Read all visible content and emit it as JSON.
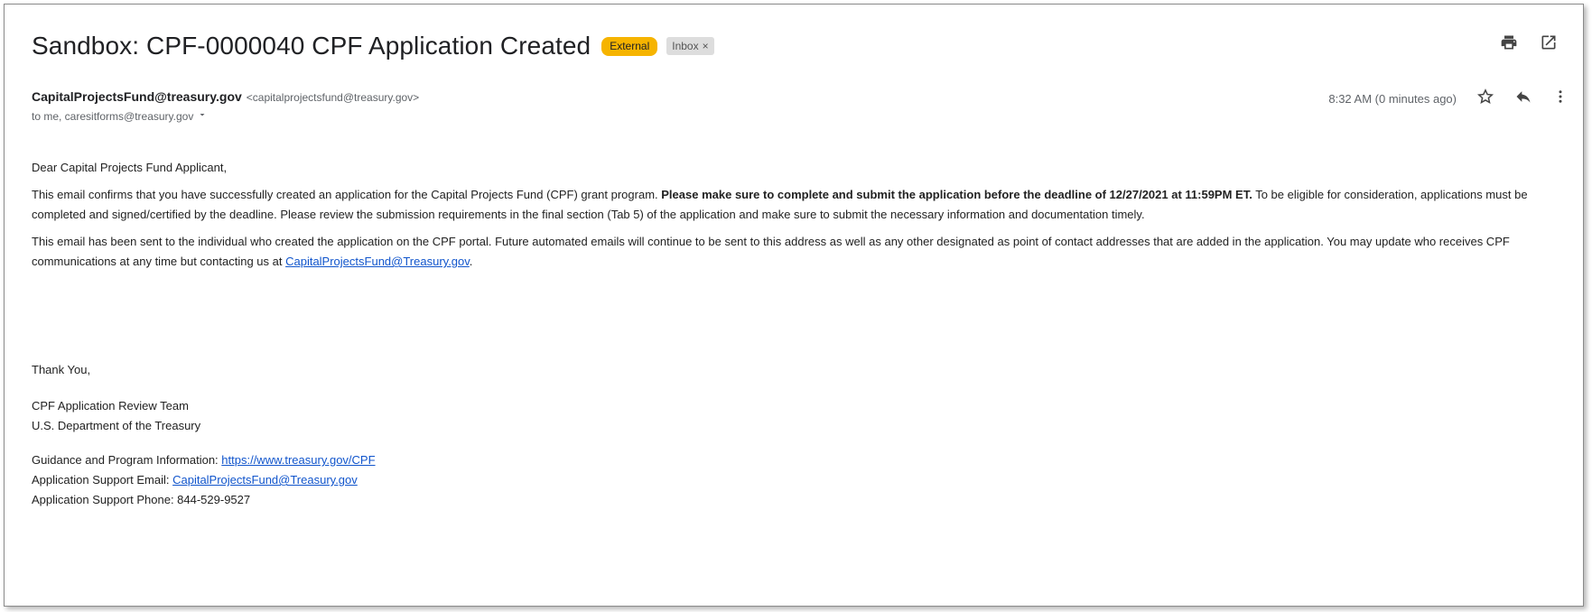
{
  "email": {
    "subject": "Sandbox: CPF-0000040 CPF Application Created",
    "labels": {
      "external": "External",
      "inbox": "Inbox",
      "inbox_remove": "×"
    },
    "sender_name": "CapitalProjectsFund@treasury.gov",
    "sender_email": "<capitalprojectsfund@treasury.gov>",
    "to_line": "to me, caresitforms@treasury.gov",
    "timestamp": "8:32 AM (0 minutes ago)"
  },
  "body": {
    "greeting": "Dear Capital Projects Fund Applicant,",
    "p1_a": "This email confirms that you have successfully created an application for the Capital Projects Fund (CPF) grant program. ",
    "p1_bold": "Please make sure to complete and submit the application before the deadline of 12/27/2021 at 11:59PM ET.",
    "p1_b": " To be eligible for consideration, applications must be completed and signed/certified by the deadline. Please review the submission requirements in the final section (Tab 5) of the application and make sure to submit the necessary information and documentation timely.",
    "p2_a": "This email has been sent to the individual who created the application on the CPF portal. Future automated emails will continue to be sent to this address as well as any other designated as point of contact addresses that are added in the application. You may update who receives CPF communications at any time but contacting us at ",
    "p2_link": "CapitalProjectsFund@Treasury.gov",
    "p2_end": ".",
    "closing": "Thank You,",
    "team": "CPF Application Review Team",
    "dept": "U.S. Department of the Treasury",
    "guidance_label": "Guidance and Program Information: ",
    "guidance_link": "https://www.treasury.gov/CPF",
    "support_email_label": "Application Support Email: ",
    "support_email_link": "CapitalProjectsFund@Treasury.gov",
    "support_phone": "Application Support Phone: 844-529-9527"
  },
  "icons": {
    "print": "print-icon",
    "open_new": "open-in-new-window-icon",
    "star": "star-icon",
    "reply": "reply-icon",
    "more": "more-vert-icon",
    "dropdown": "chevron-down-icon"
  },
  "colors": {
    "external_label": "#f6b400",
    "inbox_label": "#dddddd",
    "link": "#1155cc"
  }
}
